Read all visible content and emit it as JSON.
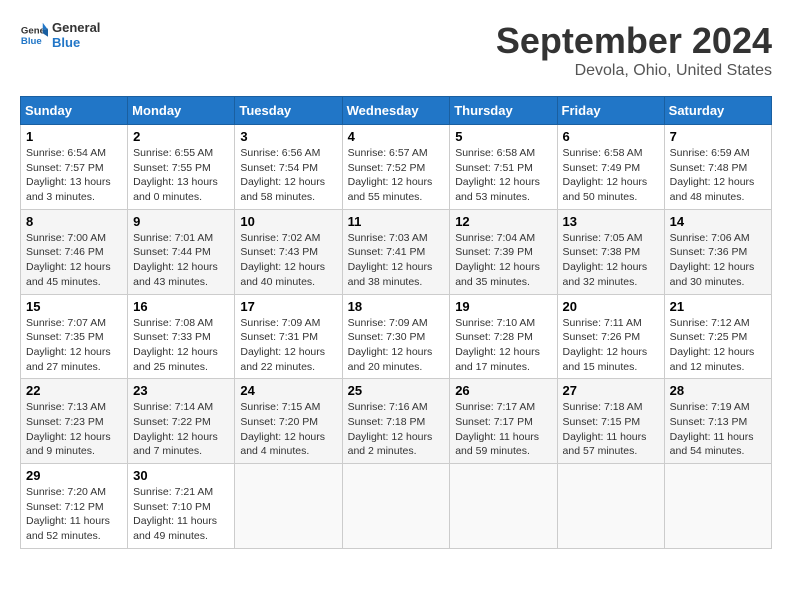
{
  "header": {
    "logo_general": "General",
    "logo_blue": "Blue",
    "month_title": "September 2024",
    "location": "Devola, Ohio, United States"
  },
  "weekdays": [
    "Sunday",
    "Monday",
    "Tuesday",
    "Wednesday",
    "Thursday",
    "Friday",
    "Saturday"
  ],
  "weeks": [
    [
      {
        "day": "1",
        "sunrise": "6:54 AM",
        "sunset": "7:57 PM",
        "daylight": "13 hours and 3 minutes."
      },
      {
        "day": "2",
        "sunrise": "6:55 AM",
        "sunset": "7:55 PM",
        "daylight": "13 hours and 0 minutes."
      },
      {
        "day": "3",
        "sunrise": "6:56 AM",
        "sunset": "7:54 PM",
        "daylight": "12 hours and 58 minutes."
      },
      {
        "day": "4",
        "sunrise": "6:57 AM",
        "sunset": "7:52 PM",
        "daylight": "12 hours and 55 minutes."
      },
      {
        "day": "5",
        "sunrise": "6:58 AM",
        "sunset": "7:51 PM",
        "daylight": "12 hours and 53 minutes."
      },
      {
        "day": "6",
        "sunrise": "6:58 AM",
        "sunset": "7:49 PM",
        "daylight": "12 hours and 50 minutes."
      },
      {
        "day": "7",
        "sunrise": "6:59 AM",
        "sunset": "7:48 PM",
        "daylight": "12 hours and 48 minutes."
      }
    ],
    [
      {
        "day": "8",
        "sunrise": "7:00 AM",
        "sunset": "7:46 PM",
        "daylight": "12 hours and 45 minutes."
      },
      {
        "day": "9",
        "sunrise": "7:01 AM",
        "sunset": "7:44 PM",
        "daylight": "12 hours and 43 minutes."
      },
      {
        "day": "10",
        "sunrise": "7:02 AM",
        "sunset": "7:43 PM",
        "daylight": "12 hours and 40 minutes."
      },
      {
        "day": "11",
        "sunrise": "7:03 AM",
        "sunset": "7:41 PM",
        "daylight": "12 hours and 38 minutes."
      },
      {
        "day": "12",
        "sunrise": "7:04 AM",
        "sunset": "7:39 PM",
        "daylight": "12 hours and 35 minutes."
      },
      {
        "day": "13",
        "sunrise": "7:05 AM",
        "sunset": "7:38 PM",
        "daylight": "12 hours and 32 minutes."
      },
      {
        "day": "14",
        "sunrise": "7:06 AM",
        "sunset": "7:36 PM",
        "daylight": "12 hours and 30 minutes."
      }
    ],
    [
      {
        "day": "15",
        "sunrise": "7:07 AM",
        "sunset": "7:35 PM",
        "daylight": "12 hours and 27 minutes."
      },
      {
        "day": "16",
        "sunrise": "7:08 AM",
        "sunset": "7:33 PM",
        "daylight": "12 hours and 25 minutes."
      },
      {
        "day": "17",
        "sunrise": "7:09 AM",
        "sunset": "7:31 PM",
        "daylight": "12 hours and 22 minutes."
      },
      {
        "day": "18",
        "sunrise": "7:09 AM",
        "sunset": "7:30 PM",
        "daylight": "12 hours and 20 minutes."
      },
      {
        "day": "19",
        "sunrise": "7:10 AM",
        "sunset": "7:28 PM",
        "daylight": "12 hours and 17 minutes."
      },
      {
        "day": "20",
        "sunrise": "7:11 AM",
        "sunset": "7:26 PM",
        "daylight": "12 hours and 15 minutes."
      },
      {
        "day": "21",
        "sunrise": "7:12 AM",
        "sunset": "7:25 PM",
        "daylight": "12 hours and 12 minutes."
      }
    ],
    [
      {
        "day": "22",
        "sunrise": "7:13 AM",
        "sunset": "7:23 PM",
        "daylight": "12 hours and 9 minutes."
      },
      {
        "day": "23",
        "sunrise": "7:14 AM",
        "sunset": "7:22 PM",
        "daylight": "12 hours and 7 minutes."
      },
      {
        "day": "24",
        "sunrise": "7:15 AM",
        "sunset": "7:20 PM",
        "daylight": "12 hours and 4 minutes."
      },
      {
        "day": "25",
        "sunrise": "7:16 AM",
        "sunset": "7:18 PM",
        "daylight": "12 hours and 2 minutes."
      },
      {
        "day": "26",
        "sunrise": "7:17 AM",
        "sunset": "7:17 PM",
        "daylight": "11 hours and 59 minutes."
      },
      {
        "day": "27",
        "sunrise": "7:18 AM",
        "sunset": "7:15 PM",
        "daylight": "11 hours and 57 minutes."
      },
      {
        "day": "28",
        "sunrise": "7:19 AM",
        "sunset": "7:13 PM",
        "daylight": "11 hours and 54 minutes."
      }
    ],
    [
      {
        "day": "29",
        "sunrise": "7:20 AM",
        "sunset": "7:12 PM",
        "daylight": "11 hours and 52 minutes."
      },
      {
        "day": "30",
        "sunrise": "7:21 AM",
        "sunset": "7:10 PM",
        "daylight": "11 hours and 49 minutes."
      },
      null,
      null,
      null,
      null,
      null
    ]
  ]
}
